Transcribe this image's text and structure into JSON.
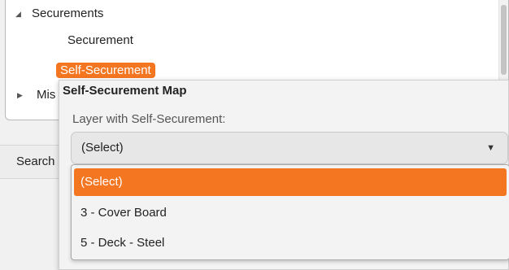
{
  "tree": {
    "group1": {
      "label": "Securements",
      "expanded": true
    },
    "children": [
      "Securement",
      "Self-Securement"
    ],
    "selected_child": "Self-Securement",
    "group2": {
      "label": "Mis",
      "expanded": false
    }
  },
  "toolbar": {
    "search_label": "Search"
  },
  "popup": {
    "title": "Self-Securement Map",
    "field_label": "Layer with Self-Securement:",
    "select_value": "(Select)",
    "options": [
      "(Select)",
      "3 - Cover Board",
      "5 - Deck - Steel"
    ],
    "selected_option": "(Select)"
  },
  "colors": {
    "accent": "#f47621"
  }
}
